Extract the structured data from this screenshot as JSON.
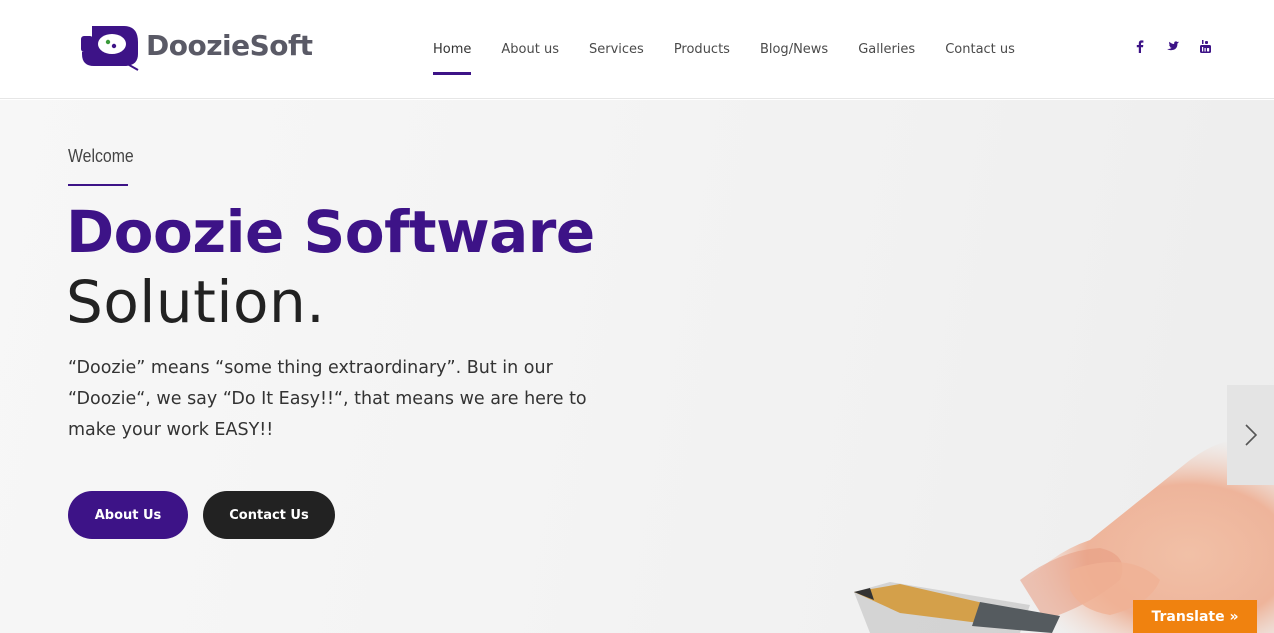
{
  "brand": {
    "name": "DoozieSoft",
    "accent_color": "#3d1387"
  },
  "nav": {
    "items": [
      {
        "label": "Home",
        "active": true
      },
      {
        "label": "About us"
      },
      {
        "label": "Services"
      },
      {
        "label": "Products"
      },
      {
        "label": "Blog/News"
      },
      {
        "label": "Galleries"
      },
      {
        "label": "Contact us"
      }
    ]
  },
  "social": [
    {
      "icon": "facebook-icon"
    },
    {
      "icon": "twitter-icon"
    },
    {
      "icon": "youtube-icon"
    }
  ],
  "hero": {
    "eyebrow": "Welcome",
    "title_strong": "Doozie Software",
    "title_light": "Solution.",
    "description": "“Doozie” means “some thing extraordinary”. But in our “Doozie“, we say “Do It Easy!!“, that means we are here to make your work EASY!!",
    "btn_about": "About Us",
    "btn_contact": "Contact Us"
  },
  "translate": {
    "label": "Translate »",
    "color": "#f0820f"
  }
}
